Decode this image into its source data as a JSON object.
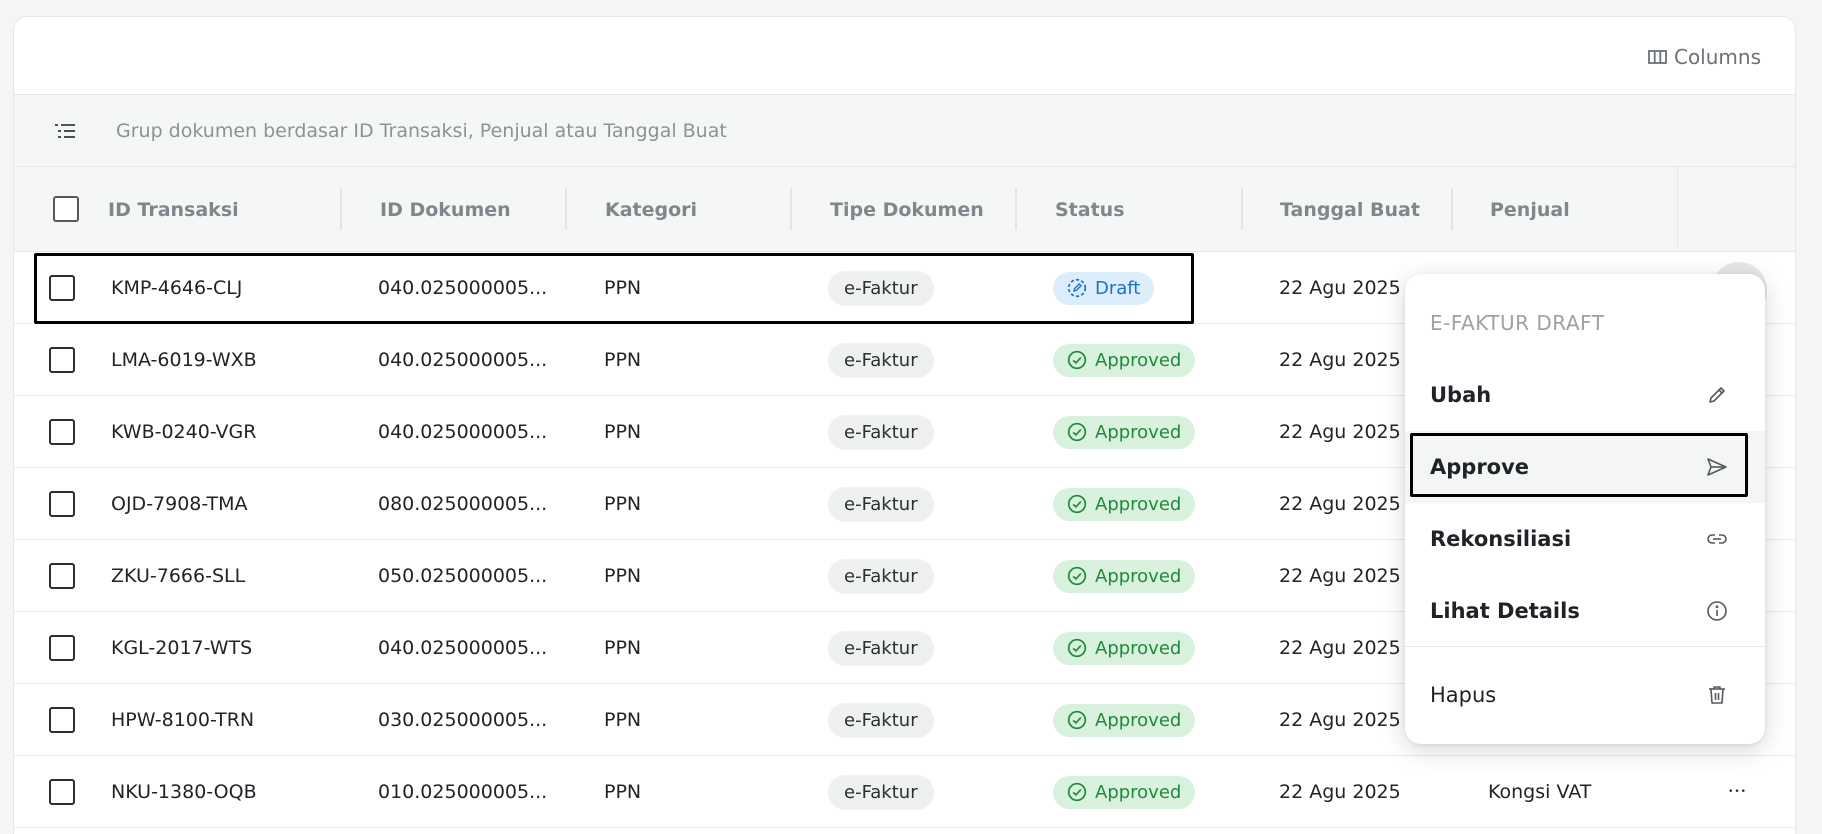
{
  "toolbar": {
    "columns_label": "Columns",
    "columns_icon": "columns-icon"
  },
  "group_bar": {
    "placeholder": "Grup dokumen berdasar ID Transaksi, Penjual atau Tanggal Buat",
    "icon": "group-list-icon"
  },
  "columns": [
    "ID Transaksi",
    "ID Dokumen",
    "Kategori",
    "Tipe Dokumen",
    "Status",
    "Tanggal Buat",
    "Penjual"
  ],
  "rows": [
    {
      "id_transaksi": "KMP-4646-CLJ",
      "id_dokumen": "040.025000005...",
      "kategori": "PPN",
      "tipe": "e-Faktur",
      "status": "Draft",
      "tanggal": "22 Agu 2025",
      "penjual": ""
    },
    {
      "id_transaksi": "LMA-6019-WXB",
      "id_dokumen": "040.025000005...",
      "kategori": "PPN",
      "tipe": "e-Faktur",
      "status": "Approved",
      "tanggal": "22 Agu 2025",
      "penjual": ""
    },
    {
      "id_transaksi": "KWB-0240-VGR",
      "id_dokumen": "040.025000005...",
      "kategori": "PPN",
      "tipe": "e-Faktur",
      "status": "Approved",
      "tanggal": "22 Agu 2025",
      "penjual": ""
    },
    {
      "id_transaksi": "OJD-7908-TMA",
      "id_dokumen": "080.025000005...",
      "kategori": "PPN",
      "tipe": "e-Faktur",
      "status": "Approved",
      "tanggal": "22 Agu 2025",
      "penjual": ""
    },
    {
      "id_transaksi": "ZKU-7666-SLL",
      "id_dokumen": "050.025000005...",
      "kategori": "PPN",
      "tipe": "e-Faktur",
      "status": "Approved",
      "tanggal": "22 Agu 2025",
      "penjual": ""
    },
    {
      "id_transaksi": "KGL-2017-WTS",
      "id_dokumen": "040.025000005...",
      "kategori": "PPN",
      "tipe": "e-Faktur",
      "status": "Approved",
      "tanggal": "22 Agu 2025",
      "penjual": ""
    },
    {
      "id_transaksi": "HPW-8100-TRN",
      "id_dokumen": "030.025000005...",
      "kategori": "PPN",
      "tipe": "e-Faktur",
      "status": "Approved",
      "tanggal": "22 Agu 2025",
      "penjual": ""
    },
    {
      "id_transaksi": "NKU-1380-OQB",
      "id_dokumen": "010.025000005...",
      "kategori": "PPN",
      "tipe": "e-Faktur",
      "status": "Approved",
      "tanggal": "22 Agu 2025",
      "penjual": "Kongsi VAT"
    }
  ],
  "context_menu": {
    "title": "E-FAKTUR DRAFT",
    "items": [
      {
        "label": "Ubah",
        "icon": "pencil-icon"
      },
      {
        "label": "Approve",
        "icon": "send-icon"
      },
      {
        "label": "Rekonsiliasi",
        "icon": "link-icon"
      },
      {
        "label": "Lihat Details",
        "icon": "info-icon"
      },
      {
        "label": "Hapus",
        "icon": "trash-icon"
      }
    ]
  },
  "colors": {
    "approved_bg": "#d8f2dd",
    "approved_text": "#1e8a3c",
    "draft_bg": "#dcedfc",
    "draft_text": "#1d6fd0"
  }
}
